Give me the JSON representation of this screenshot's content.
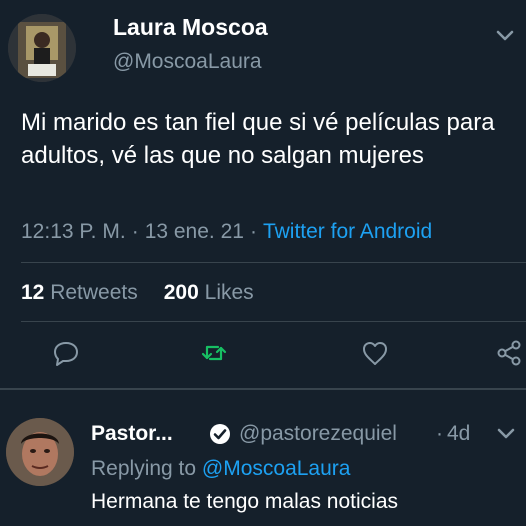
{
  "tweet": {
    "author_name": "Laura Moscoa",
    "author_handle": "@MoscoaLaura",
    "text": "Mi marido es tan fiel que si vé películas para adultos, vé las que no salgan mujeres",
    "time": "12:13 P. M.",
    "date": "13 ene. 21",
    "separator": "·",
    "source": "Twitter for Android",
    "retweets_count": "12",
    "retweets_label": "Retweets",
    "likes_count": "200",
    "likes_label": "Likes",
    "actions": [
      "reply-icon",
      "retweet-icon",
      "like-icon",
      "share-icon"
    ]
  },
  "reply": {
    "author_name": "Pastor...",
    "author_handle": "@pastorezequiel",
    "separator": "·",
    "time": "4d",
    "replying_prefix": "Replying to",
    "replying_to": "@MoscoaLaura",
    "text": "Hermana te tengo malas noticias"
  },
  "colors": {
    "background": "#15202b",
    "secondary_text": "#8899a6",
    "link": "#1da1f2",
    "retweet_green": "#17bf63",
    "divider": "#38444d"
  }
}
